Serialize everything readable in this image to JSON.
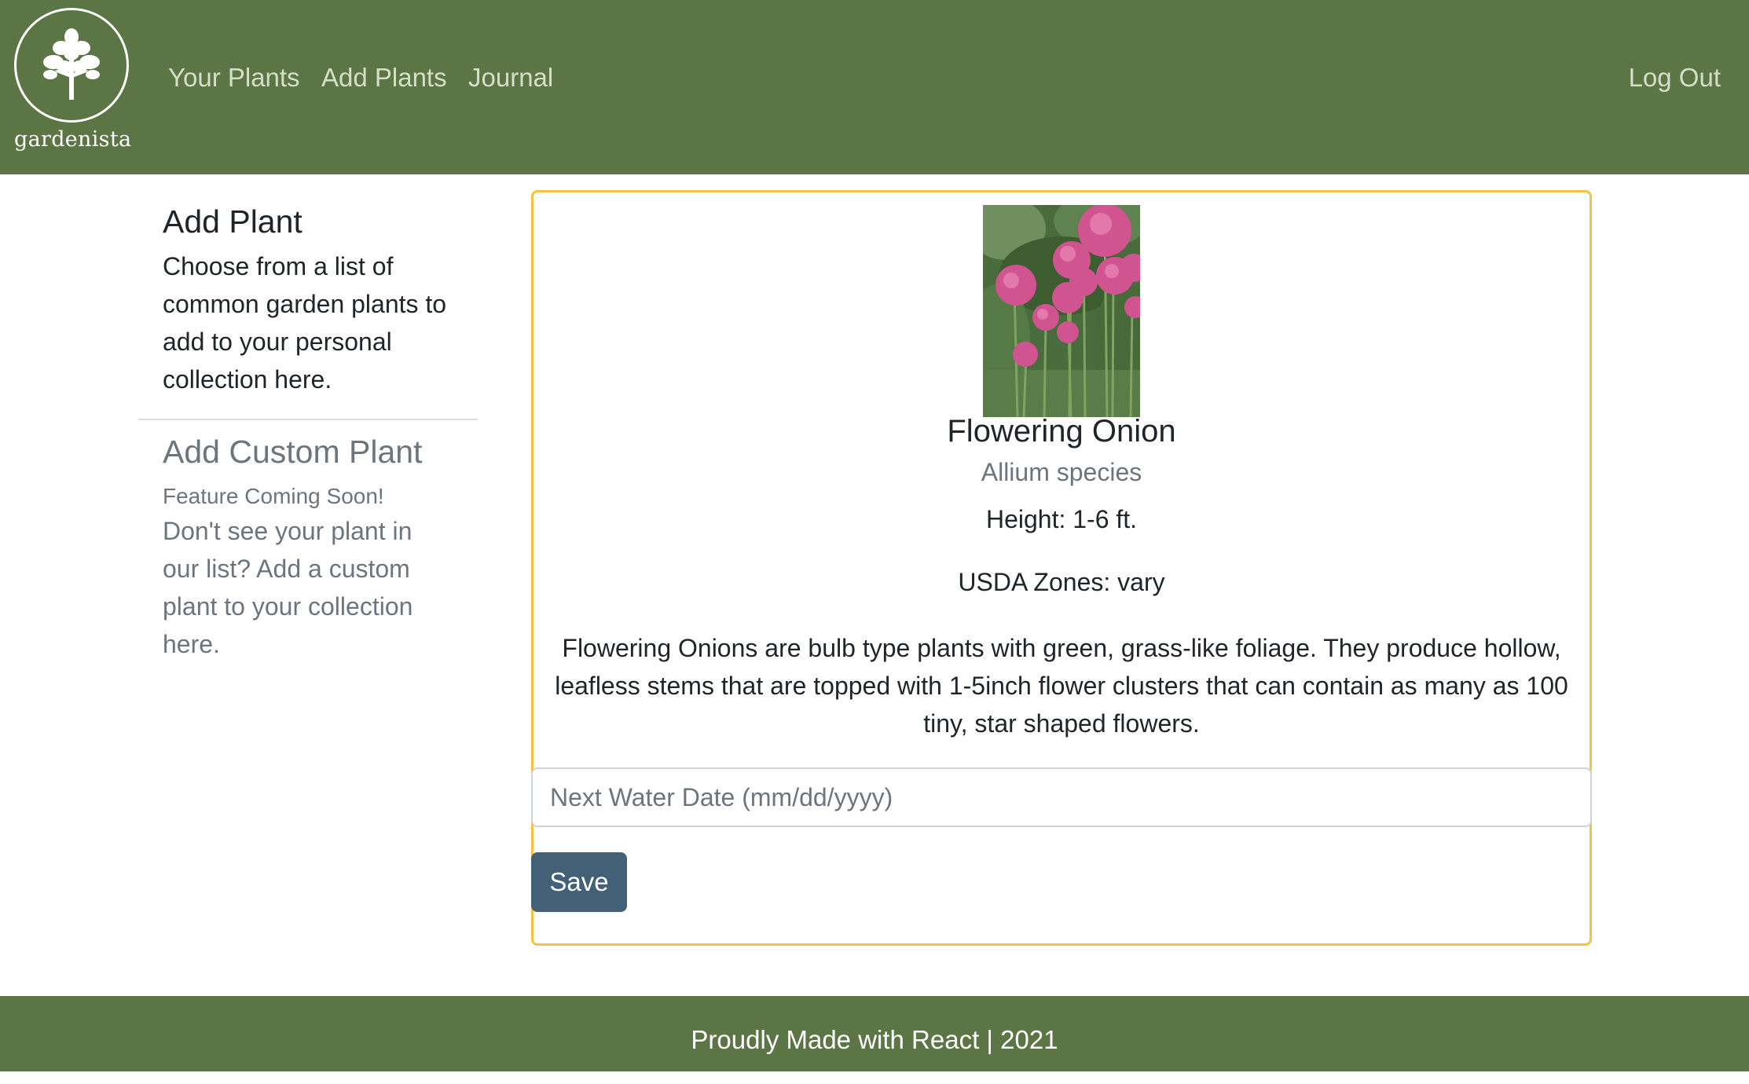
{
  "brand": {
    "name": "gardenista",
    "logo_icon": "tree-icon"
  },
  "nav": {
    "links": [
      "Your Plants",
      "Add Plants",
      "Journal"
    ],
    "logout": "Log Out"
  },
  "sidebar": {
    "add_plant": {
      "title": "Add Plant",
      "text": "Choose from a list of common garden plants to add to your personal collection here."
    },
    "add_custom_plant": {
      "title": "Add Custom Plant",
      "badge": "Feature Coming Soon!",
      "text": "Don't see your plant in our list? Add a custom plant to your collection here."
    }
  },
  "plant": {
    "photo_icon": "flowering-onion-photo",
    "name": "Flowering Onion",
    "scientific_name": "Allium species",
    "height": "Height: 1-6 ft.",
    "zones": "USDA Zones: vary",
    "description": "Flowering Onions are bulb type plants with green, grass-like foliage. They produce hollow, leafless stems that are topped with 1-5inch flower clusters that can contain as many as 100 tiny, star shaped flowers."
  },
  "form": {
    "water_date_placeholder": "Next Water Date (mm/dd/yyyy)",
    "water_date_value": "",
    "save_label": "Save"
  },
  "footer": {
    "text": "Proudly Made with React | 2021"
  },
  "colors": {
    "brand_green": "#5b7544",
    "card_border": "#f4c343",
    "save_button": "#426177",
    "muted_text": "#6c757d"
  }
}
